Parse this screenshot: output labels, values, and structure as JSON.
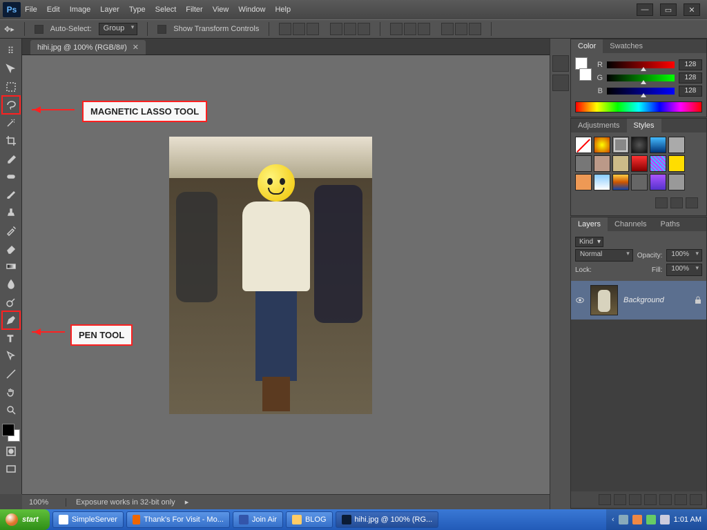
{
  "app": {
    "logo": "Ps"
  },
  "menu": [
    "File",
    "Edit",
    "Image",
    "Layer",
    "Type",
    "Select",
    "Filter",
    "View",
    "Window",
    "Help"
  ],
  "options": {
    "auto_select": "Auto-Select:",
    "group": "Group",
    "show_transform": "Show Transform Controls"
  },
  "document": {
    "tab": "hihi.jpg @ 100% (RGB/8#)",
    "zoom": "100%",
    "status": "Exposure works in 32-bit only"
  },
  "annotations": {
    "lasso": "MAGNETIC LASSO TOOL",
    "pen": "PEN TOOL"
  },
  "panels": {
    "color": {
      "tabs": [
        "Color",
        "Swatches"
      ],
      "r_label": "R",
      "g_label": "G",
      "b_label": "B",
      "r": "128",
      "g": "128",
      "b": "128"
    },
    "styles": {
      "tabs": [
        "Adjustments",
        "Styles"
      ]
    },
    "layers": {
      "tabs": [
        "Layers",
        "Channels",
        "Paths"
      ],
      "kind": "Kind",
      "mode": "Normal",
      "opacity_label": "Opacity:",
      "opacity": "100%",
      "lock_label": "Lock:",
      "fill_label": "Fill:",
      "fill": "100%",
      "layer_name": "Background"
    }
  },
  "taskbar": {
    "start": "start",
    "items": [
      "SimpleServer",
      "Thank's For Visit - Mo...",
      "Join Air",
      "BLOG",
      "hihi.jpg @ 100% (RG..."
    ],
    "clock": "1:01 AM"
  }
}
